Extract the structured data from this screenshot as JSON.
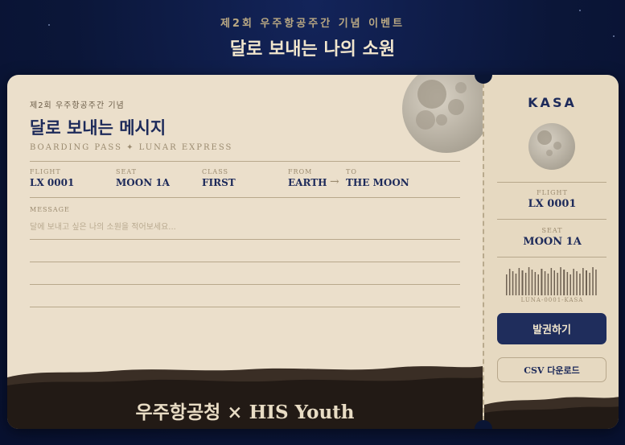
{
  "header": {
    "subtitle": "제2회 우주항공주간 기념 이벤트",
    "title": "달로 보내는 나의 소원"
  },
  "ticket": {
    "kicker": "제2회 우주항공주간 기념",
    "title": "달로 보내는 메시지",
    "boarding_pass": "BOARDING PASS  ✦  LUNAR EXPRESS",
    "fields": {
      "flight_label": "FLIGHT",
      "flight_value": "LX 0001",
      "seat_label": "SEAT",
      "seat_value": "MOON 1A",
      "class_label": "CLASS",
      "class_value": "FIRST",
      "from_label": "FROM",
      "from_value": "EARTH",
      "arrow": "→",
      "to_label": "TO",
      "to_value": "THE MOON"
    },
    "message_label": "MESSAGE",
    "message_placeholder": "달에 보내고 싶은 나의 소원을 적어보세요...",
    "footer": "우주항공청 × HIS Youth"
  },
  "stub": {
    "brand": "KASA",
    "flight_label": "FLIGHT",
    "flight_value": "LX 0001",
    "seat_label": "SEAT",
    "seat_value": "MOON 1A",
    "barcode_text": "LUNA-0001-KASA",
    "issue_button": "발권하기",
    "csv_button": "CSV 다운로드"
  },
  "icons": {
    "moon": "moon-icon",
    "barcode": "barcode-icon"
  },
  "colors": {
    "navy": "#1d2a5a",
    "paper": "#ebdfcb",
    "ground": "#221a15",
    "night": "#0b1638"
  }
}
